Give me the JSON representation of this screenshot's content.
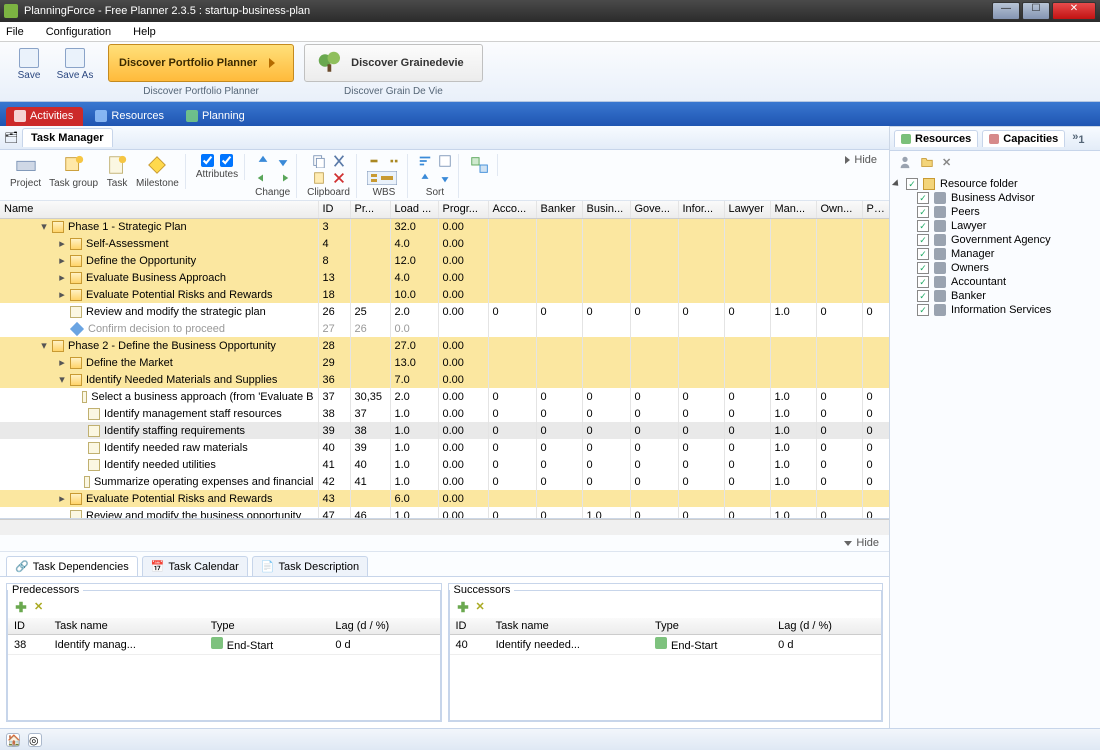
{
  "window": {
    "title": "PlanningForce - Free Planner 2.3.5 : startup-business-plan"
  },
  "menu": {
    "file": "File",
    "config": "Configuration",
    "help": "Help"
  },
  "ribbon": {
    "save": "Save",
    "saveas": "Save As",
    "portfolio_btn": "Discover Portfolio Planner",
    "portfolio_caption": "Discover Portfolio Planner",
    "grain_btn": "Discover Grainedevie",
    "grain_caption": "Discover Grain De Vie"
  },
  "nav": {
    "activities": "Activities",
    "resources": "Resources",
    "planning": "Planning"
  },
  "taskmgr": {
    "label": "Task Manager",
    "hide": "Hide"
  },
  "toolbar": {
    "project": "Project",
    "taskgroup": "Task group",
    "task": "Task",
    "milestone": "Milestone",
    "attributes": "Attributes",
    "change": "Change",
    "clipboard": "Clipboard",
    "wbs": "WBS",
    "sort": "Sort"
  },
  "columns": [
    "Name",
    "ID",
    "Pr...",
    "Load ...",
    "Progr...",
    "Acco...",
    "Banker",
    "Busin...",
    "Gove...",
    "Infor...",
    "Lawyer",
    "Man...",
    "Own...",
    "Pe..."
  ],
  "rows": [
    {
      "level": 1,
      "cls": "yellow",
      "exp": "▾",
      "ico": "box",
      "name": "Phase 1 - Strategic Plan",
      "cells": [
        "3",
        "",
        "32.0",
        "0.00",
        "",
        "",
        "",
        "",
        "",
        "",
        "",
        "",
        ""
      ]
    },
    {
      "level": 2,
      "cls": "yellow",
      "exp": "▸",
      "ico": "box",
      "name": "Self-Assessment",
      "cells": [
        "4",
        "",
        "4.0",
        "0.00",
        "",
        "",
        "",
        "",
        "",
        "",
        "",
        "",
        ""
      ]
    },
    {
      "level": 2,
      "cls": "yellow",
      "exp": "▸",
      "ico": "box",
      "name": "Define the Opportunity",
      "cells": [
        "8",
        "",
        "12.0",
        "0.00",
        "",
        "",
        "",
        "",
        "",
        "",
        "",
        "",
        ""
      ]
    },
    {
      "level": 2,
      "cls": "yellow",
      "exp": "▸",
      "ico": "box",
      "name": "Evaluate Business Approach",
      "cells": [
        "13",
        "",
        "4.0",
        "0.00",
        "",
        "",
        "",
        "",
        "",
        "",
        "",
        "",
        ""
      ]
    },
    {
      "level": 2,
      "cls": "yellow",
      "exp": "▸",
      "ico": "box",
      "name": "Evaluate Potential Risks and Rewards",
      "cells": [
        "18",
        "",
        "10.0",
        "0.00",
        "",
        "",
        "",
        "",
        "",
        "",
        "",
        "",
        ""
      ]
    },
    {
      "level": 2,
      "cls": "plain",
      "exp": "",
      "ico": "sheet",
      "name": "Review and modify the strategic plan",
      "cells": [
        "26",
        "25",
        "2.0",
        "0.00",
        "0",
        "0",
        "0",
        "0",
        "0",
        "0",
        "1.0",
        "0",
        "0"
      ]
    },
    {
      "level": 2,
      "cls": "plain grey",
      "exp": "",
      "ico": "diamond",
      "name": "Confirm decision to proceed",
      "cells": [
        "27",
        "26",
        "0.0",
        "",
        "",
        "",
        "",
        "",
        "",
        "",
        "",
        "",
        ""
      ]
    },
    {
      "level": 1,
      "cls": "yellow",
      "exp": "▾",
      "ico": "box",
      "name": "Phase 2 - Define the Business Opportunity",
      "cells": [
        "28",
        "",
        "27.0",
        "0.00",
        "",
        "",
        "",
        "",
        "",
        "",
        "",
        "",
        ""
      ]
    },
    {
      "level": 2,
      "cls": "yellow",
      "exp": "▸",
      "ico": "box",
      "name": "Define the Market",
      "cells": [
        "29",
        "",
        "13.0",
        "0.00",
        "",
        "",
        "",
        "",
        "",
        "",
        "",
        "",
        ""
      ]
    },
    {
      "level": 2,
      "cls": "yellow",
      "exp": "▾",
      "ico": "box",
      "name": "Identify Needed Materials and Supplies",
      "cells": [
        "36",
        "",
        "7.0",
        "0.00",
        "",
        "",
        "",
        "",
        "",
        "",
        "",
        "",
        ""
      ]
    },
    {
      "level": 3,
      "cls": "plain",
      "exp": "",
      "ico": "sheet",
      "name": "Select a business approach (from 'Evaluate B",
      "cells": [
        "37",
        "30,35",
        "2.0",
        "0.00",
        "0",
        "0",
        "0",
        "0",
        "0",
        "0",
        "1.0",
        "0",
        "0"
      ]
    },
    {
      "level": 3,
      "cls": "plain",
      "exp": "",
      "ico": "sheet",
      "name": "Identify management staff resources",
      "cells": [
        "38",
        "37",
        "1.0",
        "0.00",
        "0",
        "0",
        "0",
        "0",
        "0",
        "0",
        "1.0",
        "0",
        "0"
      ]
    },
    {
      "level": 3,
      "cls": "sel",
      "exp": "",
      "ico": "sheet",
      "name": "Identify staffing requirements",
      "cells": [
        "39",
        "38",
        "1.0",
        "0.00",
        "0",
        "0",
        "0",
        "0",
        "0",
        "0",
        "1.0",
        "0",
        "0"
      ]
    },
    {
      "level": 3,
      "cls": "plain",
      "exp": "",
      "ico": "sheet",
      "name": "Identify needed raw materials",
      "cells": [
        "40",
        "39",
        "1.0",
        "0.00",
        "0",
        "0",
        "0",
        "0",
        "0",
        "0",
        "1.0",
        "0",
        "0"
      ]
    },
    {
      "level": 3,
      "cls": "plain",
      "exp": "",
      "ico": "sheet",
      "name": "Identify needed utilities",
      "cells": [
        "41",
        "40",
        "1.0",
        "0.00",
        "0",
        "0",
        "0",
        "0",
        "0",
        "0",
        "1.0",
        "0",
        "0"
      ]
    },
    {
      "level": 3,
      "cls": "plain",
      "exp": "",
      "ico": "sheet",
      "name": "Summarize operating expenses and financial",
      "cells": [
        "42",
        "41",
        "1.0",
        "0.00",
        "0",
        "0",
        "0",
        "0",
        "0",
        "0",
        "1.0",
        "0",
        "0"
      ]
    },
    {
      "level": 2,
      "cls": "yellow",
      "exp": "▸",
      "ico": "box",
      "name": "Evaluate Potential Risks and Rewards",
      "cells": [
        "43",
        "",
        "6.0",
        "0.00",
        "",
        "",
        "",
        "",
        "",
        "",
        "",
        "",
        ""
      ]
    },
    {
      "level": 2,
      "cls": "plain",
      "exp": "",
      "ico": "sheet",
      "name": "Review and modify the business opportunity",
      "cells": [
        "47",
        "46",
        "1.0",
        "0.00",
        "0",
        "0",
        "1.0",
        "0",
        "0",
        "0",
        "1.0",
        "0",
        "0"
      ]
    }
  ],
  "bottom_tabs": {
    "dep": "Task Dependencies",
    "cal": "Task Calendar",
    "desc": "Task Description"
  },
  "dep": {
    "pred_title": "Predecessors",
    "succ_title": "Successors",
    "cols": [
      "ID",
      "Task name",
      "Type",
      "Lag (d / %)"
    ],
    "pred": {
      "id": "38",
      "name": "Identify manag...",
      "type": "End-Start",
      "lag": "0 d"
    },
    "succ": {
      "id": "40",
      "name": "Identify needed...",
      "type": "End-Start",
      "lag": "0 d"
    }
  },
  "right": {
    "tab_res": "Resources",
    "tab_cap": "Capacities",
    "folder": "Resource folder",
    "items": [
      "Business Advisor",
      "Peers",
      "Lawyer",
      "Government Agency",
      "Manager",
      "Owners",
      "Accountant",
      "Banker",
      "Information Services"
    ]
  }
}
